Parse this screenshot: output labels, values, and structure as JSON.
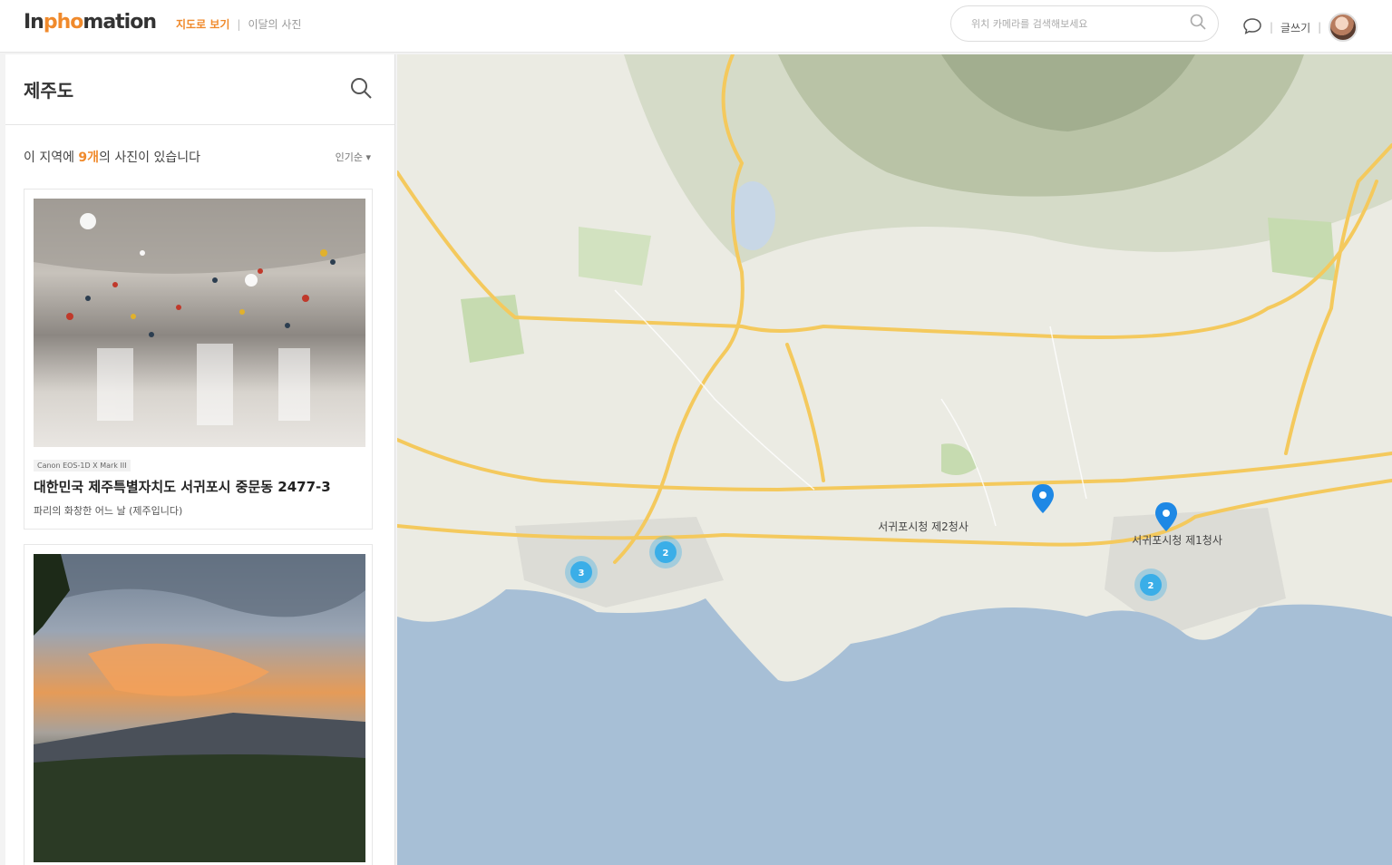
{
  "header": {
    "logo_prefix": "In",
    "logo_pho": "pho",
    "logo_suffix": "mation",
    "nav_active": "지도로 보기",
    "nav_separator": "|",
    "nav_inactive": "이달의 사진",
    "search_placeholder": "위치 카메라를 검색해보세요",
    "write_label": "글쓰기",
    "separator": "|"
  },
  "sidebar": {
    "search_value": "제주도",
    "count_prefix": "이 지역에 ",
    "count_number": "9개",
    "count_suffix": "의 사진이 있습니다",
    "sort_label": "인기순 ▾",
    "cards": [
      {
        "camera": "Canon EOS-1D X Mark III",
        "title": "대한민국 제주특별자치도 서귀포시 중문동 2477-3",
        "subtitle": "파리의 화창한 어느 날 (제주입니다)"
      },
      {
        "camera": "",
        "title": "",
        "subtitle": ""
      }
    ]
  },
  "map": {
    "clusters": [
      {
        "count": "3"
      },
      {
        "count": "2"
      },
      {
        "count": "2"
      }
    ],
    "city_label_1": "서귀포시청 제2청사",
    "city_label_2": "서귀포시청 제1청사",
    "colors": {
      "sea": "#a7bfd6",
      "land": "#ebebe3",
      "road": "#f4c95d",
      "cluster": "#3aaee8",
      "pin": "#1e88e5"
    }
  }
}
